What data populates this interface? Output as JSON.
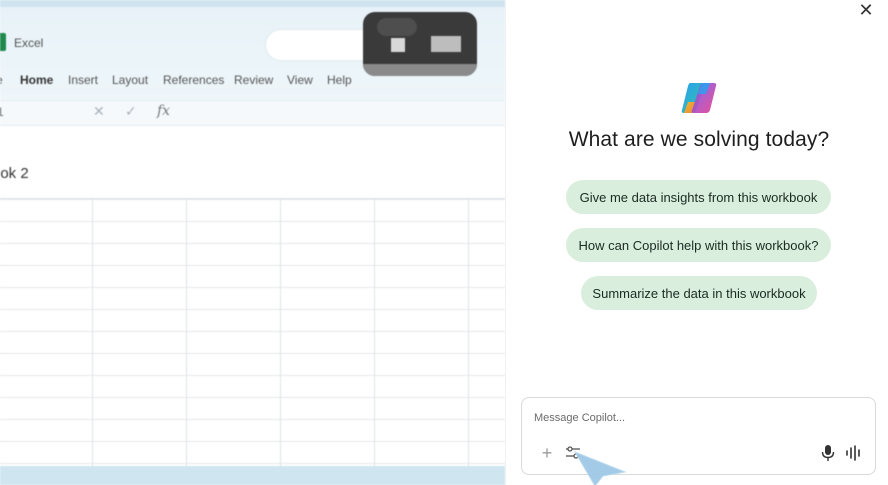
{
  "excel": {
    "app_name": "Excel",
    "ribbon_tabs": [
      {
        "label": "e"
      },
      {
        "label": "Home"
      },
      {
        "label": "Insert"
      },
      {
        "label": "Layout"
      },
      {
        "label": "References"
      },
      {
        "label": "Review"
      },
      {
        "label": "View"
      },
      {
        "label": "Help"
      }
    ],
    "formula_bar": {
      "cancel_symbol": "✕",
      "enter_symbol": "✓",
      "fx_label": "fx",
      "name_box": "1"
    },
    "workbook_title": "ook 2"
  },
  "copilot": {
    "close_symbol": "✕",
    "headline": "What are we solving today?",
    "suggestions": [
      "Give me data insights from this workbook",
      "How can Copilot help with this workbook?",
      "Summarize the data in this workbook"
    ],
    "composer": {
      "placeholder": "Message Copilot...",
      "add_symbol": "+"
    },
    "logo_colors": [
      "#2ba0f0",
      "#f7b32b",
      "#e8408e",
      "#7a5cf0"
    ],
    "chip_color": "#d9eedd"
  }
}
